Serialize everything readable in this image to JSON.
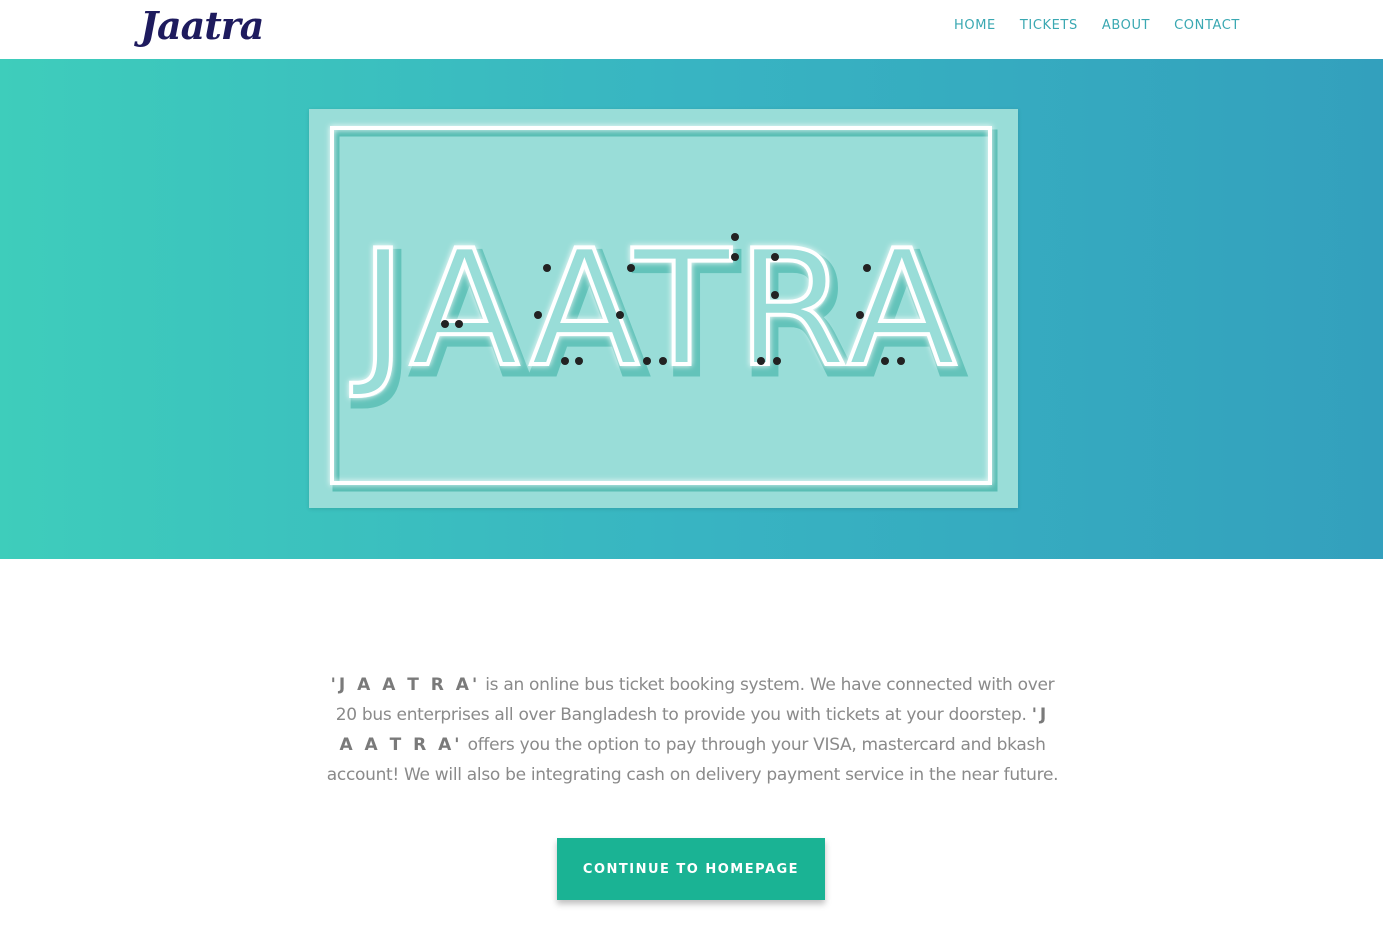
{
  "header": {
    "logo": "Jaatra",
    "nav": [
      "HOME",
      "TICKETS",
      "ABOUT",
      "CONTACT"
    ]
  },
  "hero": {
    "sign_text": "JAATRA"
  },
  "about": {
    "brand_1": "'J A A T R A'",
    "text_1": " is an online bus ticket booking system. We have connected with over 20 bus enterprises all over Bangladesh to provide you with tickets at your doorstep. ",
    "brand_2": "'J A A T R A'",
    "text_2": " offers you the option to pay through your VISA, mastercard and bkash account! We will also be integrating cash on delivery payment service in the near future."
  },
  "cta": {
    "label": "CONTINUE TO HOMEPAGE"
  },
  "colors": {
    "brand_navy": "#1e1b5e",
    "nav_teal": "#3aa8b2",
    "hero_left": "#3ecdbb",
    "hero_right": "#33a0bd",
    "button_green": "#1ab394"
  }
}
